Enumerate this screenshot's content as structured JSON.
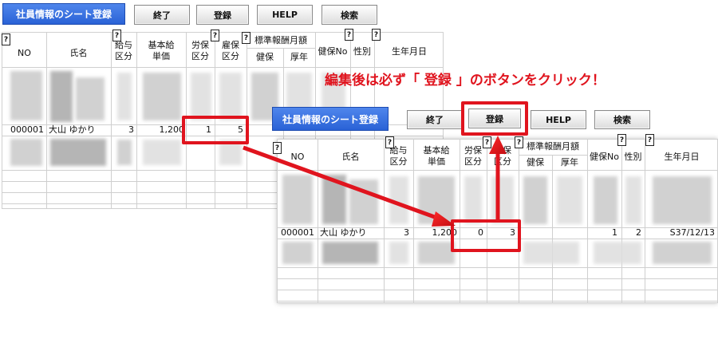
{
  "toolbar": {
    "title_label": "社員情報のシート登録",
    "exit_label": "終了",
    "register_label": "登録",
    "help_label": "HELP",
    "search_label": "検索"
  },
  "help_mark": "?",
  "headers": {
    "no": "NO",
    "name": "氏名",
    "salary_class": "給与\n区分",
    "base_pay": "基本給\n単価",
    "labor_ins": "労保\n区分",
    "employ_ins": "雇保\n区分",
    "std_remuneration": "標準報酬月額",
    "health": "健保",
    "pension": "厚年",
    "health_no": "健保No",
    "gender": "性別",
    "birthdate": "生年月日"
  },
  "before_row": {
    "no": "000001",
    "name": "大山 ゆかり",
    "salary_class": "3",
    "base_pay": "1,200",
    "labor_ins": "1",
    "employ_ins": "5"
  },
  "after_row": {
    "no": "000001",
    "name": "大山 ゆかり",
    "salary_class": "3",
    "base_pay": "1,200",
    "labor_ins": "0",
    "employ_ins": "3",
    "health_no": "1",
    "gender": "2",
    "birthdate": "S37/12/13"
  },
  "annotation": {
    "text": "編集後は必ず「 登録 」のボタンをクリック！",
    "color": "#e0141e"
  }
}
